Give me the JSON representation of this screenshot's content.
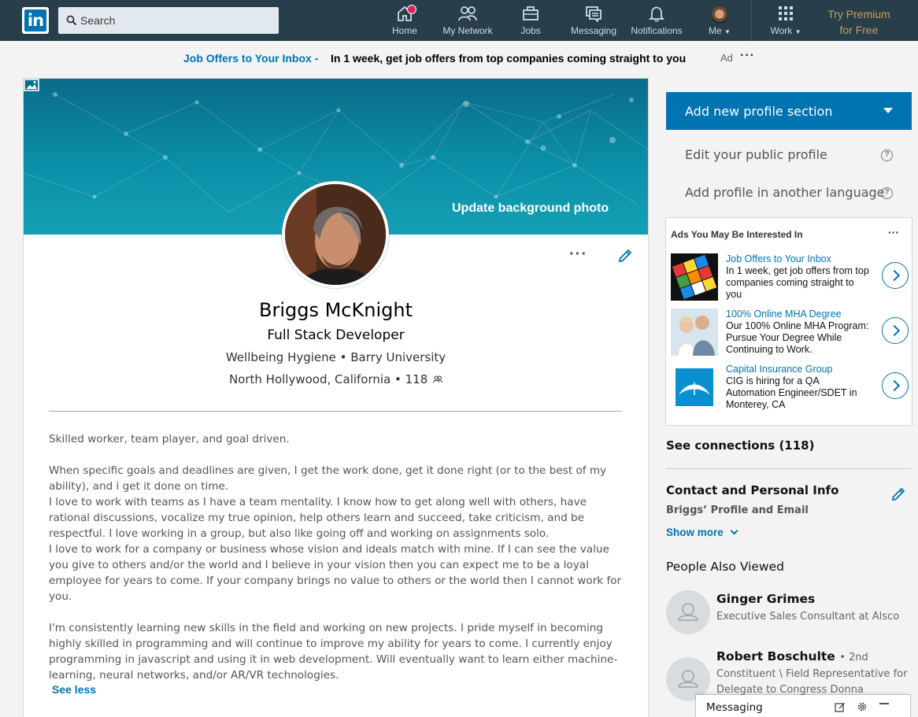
{
  "nav": {
    "logo": "in",
    "search_placeholder": "Search",
    "items": [
      {
        "label": "Home",
        "icon": "home-icon"
      },
      {
        "label": "My Network",
        "icon": "network-icon"
      },
      {
        "label": "Jobs",
        "icon": "briefcase-icon"
      },
      {
        "label": "Messaging",
        "icon": "messaging-icon"
      },
      {
        "label": "Notifications",
        "icon": "bell-icon"
      },
      {
        "label": "Me",
        "icon": "avatar"
      },
      {
        "label": "Work",
        "icon": "grid-icon"
      }
    ],
    "premium_line1": "Try Premium",
    "premium_line2": "for Free"
  },
  "ad_banner": {
    "title": "Job Offers to Your Inbox -",
    "text": "In 1 week, get job offers from top companies coming straight to you",
    "ad_label": "Ad",
    "more": "···"
  },
  "profile": {
    "update_bg": "Update background photo",
    "more": "···",
    "name": "Briggs McKnight",
    "headline": "Full Stack Developer",
    "company_line": "Wellbeing Hygiene • Barry University",
    "location_line": "North Hollywood, California • 118",
    "summary": [
      "Skilled worker, team player, and goal driven.",
      "",
      "When specific goals and deadlines are given, I get the work done, get it done right (or to the best of my ability), and i get it done on time.",
      "I love to work with teams as I have a team mentality. I know how to get along well with others, have rational discussions, vocalize my true opinion, help others learn and succeed, take criticism, and be respectful. I love working in a group, but also like going off and working on assignments solo.",
      "I love to work for a company or business whose vision and ideals match with mine. If I can see the value you give to others and/or the world and I believe in your vision then you can expect me to be a loyal employee for years to come. If your company brings no value to others or the world then I cannot work for you.",
      "",
      "I'm consistently learning new skills in the field and working on new projects. I pride myself in becoming highly skilled in programming and will continue to improve my ability for years to come. I currently enjoy programming in javascript and using it in web development. Will eventually want to learn either machine-learning, neural networks, and/or AR/VR technologies."
    ],
    "see_less": "See less"
  },
  "rail": {
    "add_section": "Add new profile section",
    "edit_public": "Edit your public profile",
    "add_language": "Add profile in another language",
    "help_glyph": "?",
    "ads_header": "Ads You May Be Interested In",
    "ads_more": "···",
    "ads": [
      {
        "title": "Job Offers to Your Inbox",
        "desc": "In 1 week, get job offers from top companies coming straight to you"
      },
      {
        "title": "100% Online MHA Degree",
        "desc": "Our 100% Online MHA Program: Pursue Your Degree While Continuing to Work."
      },
      {
        "title": "Capital Insurance Group",
        "desc": "CIG is hiring for a QA Automation Engineer/SDET in Monterey, CA"
      }
    ],
    "see_connections": "See connections (118)",
    "contact_title": "Contact and Personal Info",
    "contact_sub": "Briggs’ Profile and Email",
    "show_more": "Show more",
    "people_also_viewed": "People Also Viewed",
    "people": [
      {
        "name": "Ginger Grimes",
        "degree": "",
        "title": "Executive Sales Consultant at Alsco"
      },
      {
        "name": "Robert Boschulte",
        "degree": "• 2nd",
        "title": "Constituent \\ Field Representative for Delegate to Congress Donna Christian"
      }
    ]
  },
  "messaging_bar": {
    "label": "Messaging"
  },
  "colors": {
    "nav_bg": "#283e4a",
    "accent": "#0073b1",
    "premium": "#c6a05a"
  }
}
